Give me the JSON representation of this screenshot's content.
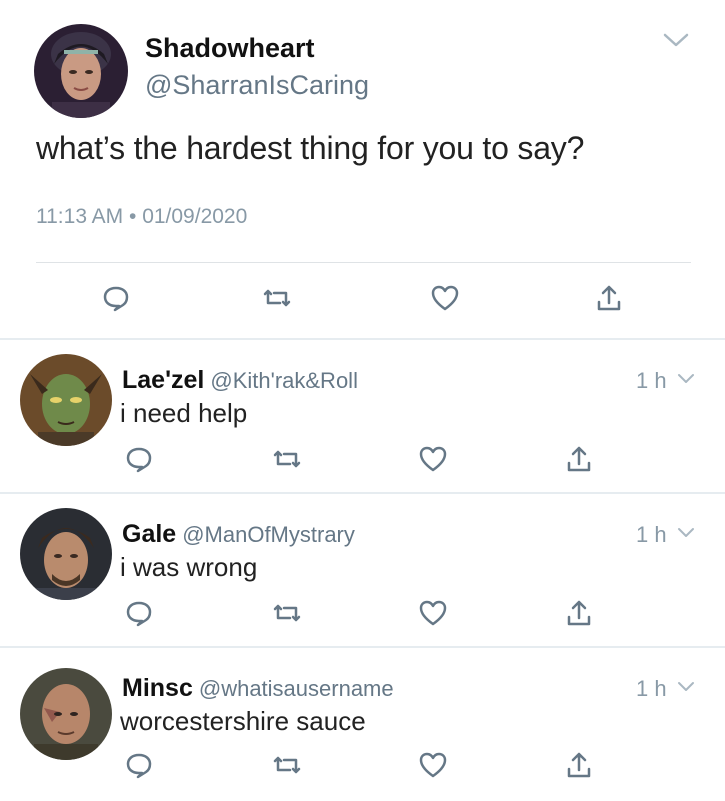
{
  "main_tweet": {
    "name": "Shadowheart",
    "handle": "@SharranIsCaring",
    "text": "what’s the hardest thing for you to say?",
    "timestamp": "11:13 AM • 01/09/2020",
    "icons": [
      "reply-icon",
      "retweet-icon",
      "like-icon",
      "share-icon"
    ]
  },
  "replies": [
    {
      "name": "Lae'zel",
      "handle": "@Kith'rak&Roll",
      "time": "1 h",
      "text": "i need help"
    },
    {
      "name": "Gale",
      "handle": "@ManOfMystrary",
      "time": "1 h",
      "text": "i was wrong"
    },
    {
      "name": "Minsc",
      "handle": "@whatisausername",
      "time": "1 h",
      "text": "worcestershire sauce"
    }
  ],
  "colors": {
    "text": "#14171a",
    "secondary": "#657786",
    "icon": "#657786",
    "divider": "#e6ecf0"
  }
}
